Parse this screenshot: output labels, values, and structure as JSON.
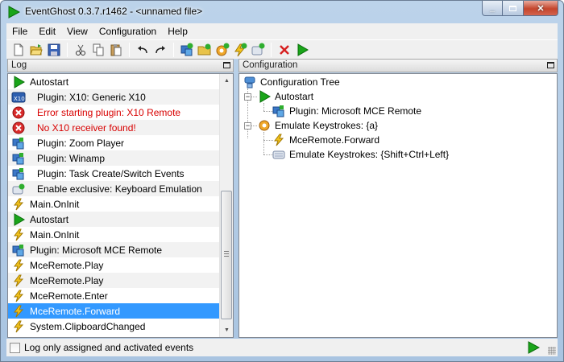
{
  "window": {
    "title": "EventGhost 0.3.7.r1462 - <unnamed file>"
  },
  "menu": [
    "File",
    "Edit",
    "View",
    "Configuration",
    "Help"
  ],
  "toolbar": {
    "buttons": [
      "new-file",
      "open-file",
      "save-file",
      "cut",
      "copy",
      "paste",
      "undo",
      "redo",
      "add-plugin",
      "add-folder",
      "add-macro",
      "add-event",
      "add-action",
      "disable",
      "execute"
    ]
  },
  "log": {
    "header": "Log",
    "rows": [
      {
        "icon": "play-icon",
        "text": "Autostart",
        "indent": false,
        "error": false
      },
      {
        "icon": "x10-plugin-icon",
        "text": "Plugin: X10: Generic X10",
        "indent": true,
        "error": false
      },
      {
        "icon": "error-icon",
        "text": "Error starting plugin: X10 Remote",
        "indent": true,
        "error": true
      },
      {
        "icon": "error-icon",
        "text": "No X10 receiver found!",
        "indent": true,
        "error": true
      },
      {
        "icon": "plugin-icon",
        "text": "Plugin: Zoom Player",
        "indent": true,
        "error": false
      },
      {
        "icon": "plugin-icon",
        "text": "Plugin: Winamp",
        "indent": true,
        "error": false
      },
      {
        "icon": "plugin-icon",
        "text": "Plugin: Task Create/Switch Events",
        "indent": true,
        "error": false
      },
      {
        "icon": "keyboard-plugin-icon",
        "text": "Enable exclusive: Keyboard Emulation",
        "indent": true,
        "error": false
      },
      {
        "icon": "lightning-icon",
        "text": "Main.OnInit",
        "indent": false,
        "error": false
      },
      {
        "icon": "play-icon",
        "text": "Autostart",
        "indent": false,
        "error": false
      },
      {
        "icon": "lightning-icon",
        "text": "Main.OnInit",
        "indent": false,
        "error": false
      },
      {
        "icon": "plugin-icon",
        "text": "Plugin: Microsoft MCE Remote",
        "indent": false,
        "error": false
      },
      {
        "icon": "lightning-icon",
        "text": "MceRemote.Play",
        "indent": false,
        "error": false
      },
      {
        "icon": "lightning-icon",
        "text": "MceRemote.Play",
        "indent": false,
        "error": false
      },
      {
        "icon": "lightning-icon",
        "text": "MceRemote.Enter",
        "indent": false,
        "error": false
      },
      {
        "icon": "lightning-icon",
        "text": "MceRemote.Forward",
        "indent": false,
        "error": false,
        "selected": true
      },
      {
        "icon": "lightning-icon",
        "text": "System.ClipboardChanged",
        "indent": false,
        "error": false
      }
    ]
  },
  "config": {
    "header": "Configuration",
    "tree": [
      {
        "icon": "config-tree-icon",
        "text": "Configuration Tree",
        "level": 0
      },
      {
        "icon": "play-icon",
        "text": "Autostart",
        "level": 1
      },
      {
        "icon": "plugin-icon",
        "text": "Plugin: Microsoft MCE Remote",
        "level": 2
      },
      {
        "icon": "macro-icon",
        "text": "Emulate Keystrokes: {a}",
        "level": 1
      },
      {
        "icon": "lightning-icon",
        "text": "MceRemote.Forward",
        "level": 2
      },
      {
        "icon": "keyboard-action-icon",
        "text": "Emulate Keystrokes: {Shift+Ctrl+Left}",
        "level": 2
      }
    ]
  },
  "status": {
    "checkbox_label": "Log only assigned and activated events",
    "checkbox_checked": false
  }
}
